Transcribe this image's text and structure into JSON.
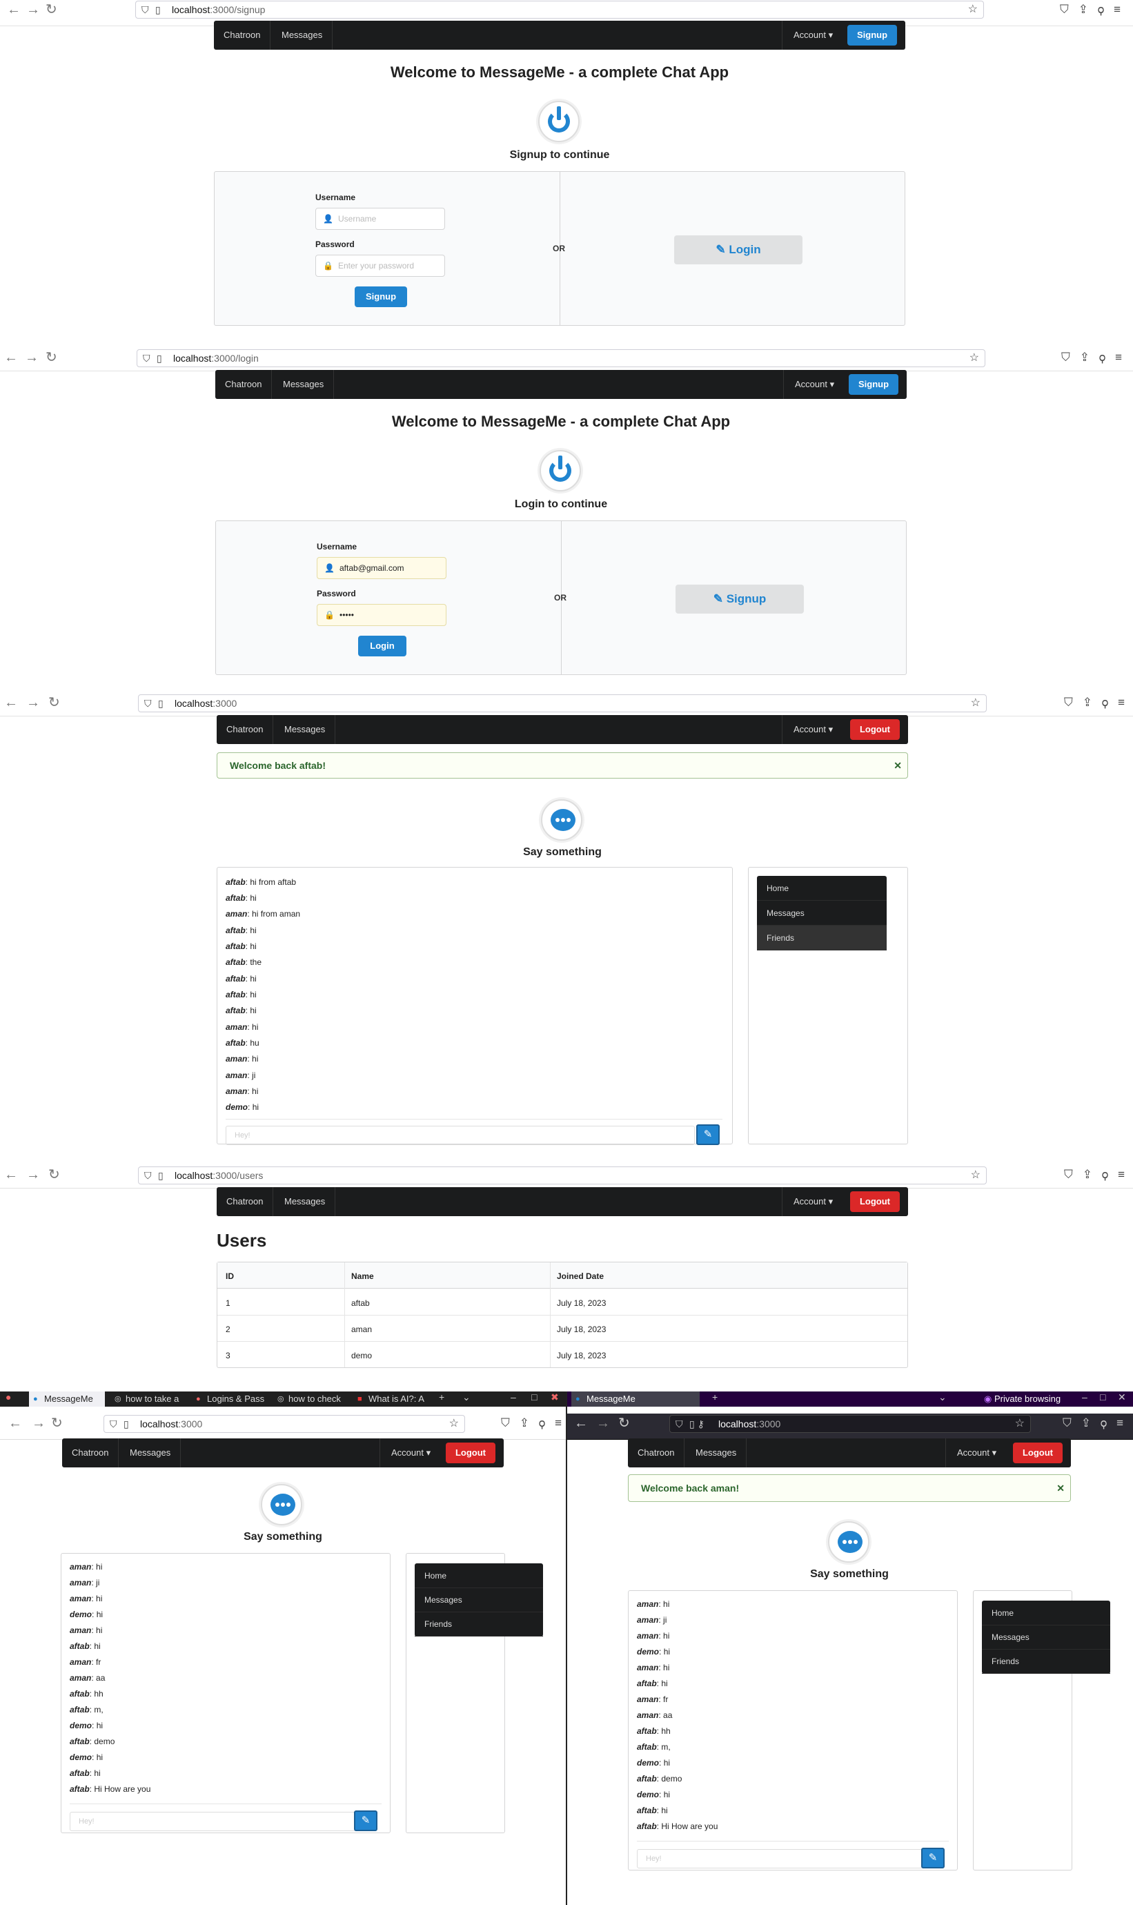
{
  "app": {
    "nav_chatroom": "Chatroon",
    "nav_messages": "Messages",
    "nav_account": "Account",
    "signup_btn": "Signup",
    "logout_btn": "Logout",
    "title": "Welcome to MessageMe - a complete Chat App"
  },
  "panel1": {
    "url_host": "localhost",
    "url_path": ":3000/signup",
    "subtitle": "Signup to continue",
    "username_label": "Username",
    "username_placeholder": "Username",
    "password_label": "Password",
    "password_placeholder": "Enter your password",
    "submit": "Signup",
    "or": "OR",
    "alt_button": "Login"
  },
  "panel2": {
    "url_host": "localhost",
    "url_path": ":3000/login",
    "subtitle": "Login to continue",
    "username_label": "Username",
    "username_value": "aftab@gmail.com",
    "password_label": "Password",
    "password_value": "•••••",
    "submit": "Login",
    "or": "OR",
    "alt_button": "Signup"
  },
  "panel3": {
    "url_host": "localhost",
    "url_path": ":3000",
    "flash": "Welcome back aftab!",
    "say": "Say something",
    "messages": [
      {
        "user": "aftab",
        "text": "hi from aftab"
      },
      {
        "user": "aftab",
        "text": "hi"
      },
      {
        "user": "aman",
        "text": "hi from aman"
      },
      {
        "user": "aftab",
        "text": "hi"
      },
      {
        "user": "aftab",
        "text": "hi"
      },
      {
        "user": "aftab",
        "text": "the"
      },
      {
        "user": "aftab",
        "text": "hi"
      },
      {
        "user": "aftab",
        "text": "hi"
      },
      {
        "user": "aftab",
        "text": "hi"
      },
      {
        "user": "aman",
        "text": "hi"
      },
      {
        "user": "aftab",
        "text": "hu"
      },
      {
        "user": "aman",
        "text": "hi"
      },
      {
        "user": "aman",
        "text": "ji"
      },
      {
        "user": "aman",
        "text": "hi"
      },
      {
        "user": "demo",
        "text": "hi"
      }
    ],
    "input_placeholder": "Hey!",
    "menu": [
      "Home",
      "Messages",
      "Friends"
    ]
  },
  "panel4": {
    "url_host": "localhost",
    "url_path": ":3000/users",
    "heading": "Users",
    "columns": [
      "ID",
      "Name",
      "Joined Date"
    ],
    "rows": [
      [
        "1",
        "aftab",
        "July 18, 2023"
      ],
      [
        "2",
        "aman",
        "July 18, 2023"
      ],
      [
        "3",
        "demo",
        "July 18, 2023"
      ]
    ]
  },
  "panel5": {
    "tabs": [
      "MessageMe",
      "how to take a",
      "Logins & Pass",
      "how to check",
      "What is AI?: A"
    ],
    "url_host": "localhost",
    "url_path": ":3000",
    "say": "Say something",
    "messages": [
      {
        "user": "aman",
        "text": "hi"
      },
      {
        "user": "aman",
        "text": "ji"
      },
      {
        "user": "aman",
        "text": "hi"
      },
      {
        "user": "demo",
        "text": "hi"
      },
      {
        "user": "aman",
        "text": "hi"
      },
      {
        "user": "aftab",
        "text": "hi"
      },
      {
        "user": "aman",
        "text": "fr"
      },
      {
        "user": "aman",
        "text": "aa"
      },
      {
        "user": "aftab",
        "text": "hh"
      },
      {
        "user": "aftab",
        "text": "m,"
      },
      {
        "user": "demo",
        "text": "hi"
      },
      {
        "user": "aftab",
        "text": "demo"
      },
      {
        "user": "demo",
        "text": "hi"
      },
      {
        "user": "aftab",
        "text": "hi"
      },
      {
        "user": "aftab",
        "text": "Hi How are you"
      }
    ],
    "input_placeholder": "Hey!",
    "menu": [
      "Home",
      "Messages",
      "Friends"
    ]
  },
  "panel6": {
    "tab": "MessageMe",
    "private": "Private browsing",
    "url_host": "localhost",
    "url_path": ":3000",
    "flash": "Welcome back aman!",
    "say": "Say something",
    "messages": [
      {
        "user": "aman",
        "text": "hi"
      },
      {
        "user": "aman",
        "text": "ji"
      },
      {
        "user": "aman",
        "text": "hi"
      },
      {
        "user": "demo",
        "text": "hi"
      },
      {
        "user": "aman",
        "text": "hi"
      },
      {
        "user": "aftab",
        "text": "hi"
      },
      {
        "user": "aman",
        "text": "fr"
      },
      {
        "user": "aman",
        "text": "aa"
      },
      {
        "user": "aftab",
        "text": "hh"
      },
      {
        "user": "aftab",
        "text": "m,"
      },
      {
        "user": "demo",
        "text": "hi"
      },
      {
        "user": "aftab",
        "text": "demo"
      },
      {
        "user": "demo",
        "text": "hi"
      },
      {
        "user": "aftab",
        "text": "hi"
      },
      {
        "user": "aftab",
        "text": "Hi How are you"
      }
    ],
    "input_placeholder": "Hey!",
    "menu": [
      "Home",
      "Messages",
      "Friends"
    ]
  }
}
